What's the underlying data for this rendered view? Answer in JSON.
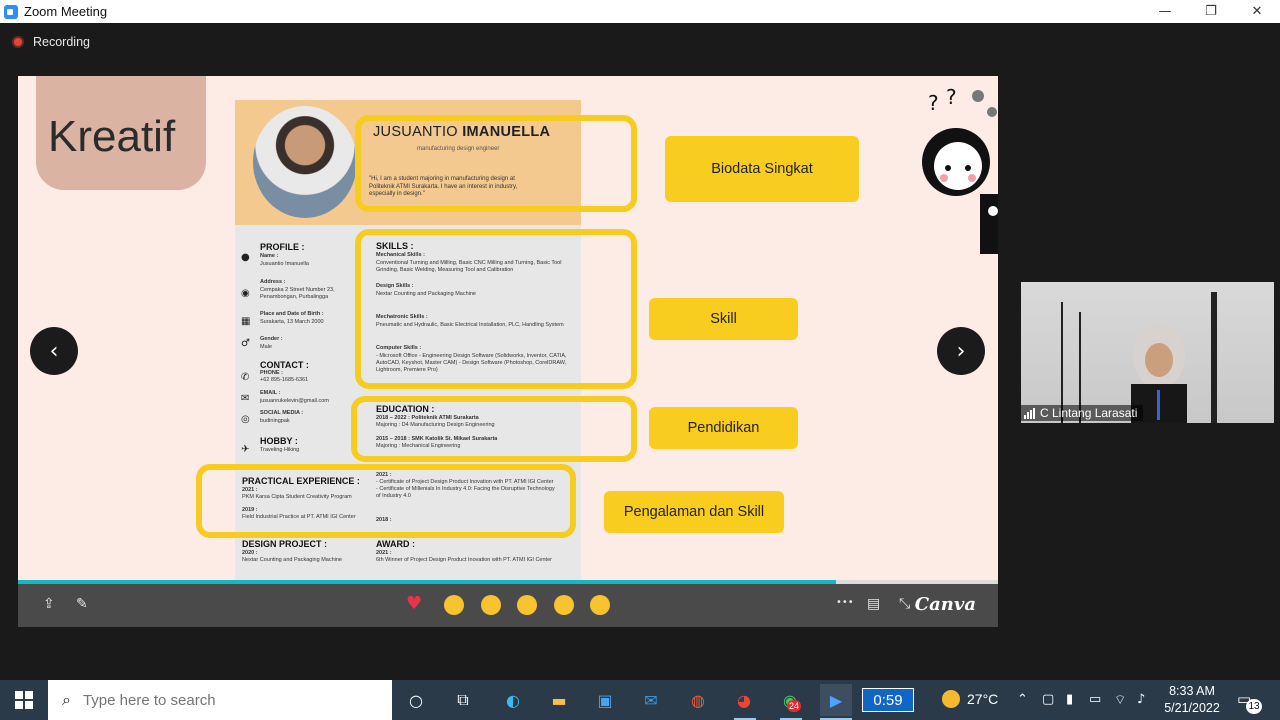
{
  "window": {
    "title": "Zoom Meeting",
    "minimize": "—",
    "restore": "❐",
    "close": "✕"
  },
  "recording": {
    "label": "Recording"
  },
  "slide": {
    "heading": "Kreatif",
    "cv": {
      "first_name": "JUSUANTIO",
      "last_name": "IMANUELLA",
      "subtitle": "manufacturing design engineer",
      "quote": "\"Hi, I am a student majoring in manufacturing design at Politeknik ATMI Surakarta. I have an interest in industry, especially in design.\"",
      "profile_heading": "PROFILE :",
      "name_label": "Name :",
      "name_value": "Jusuantio Imanuella",
      "address_label": "Address :",
      "address_value": "Cempaka 2 Street Number 23, Penambongan, Purbalingga",
      "birth_label": "Place and Date of Birth :",
      "birth_value": "Surakarta, 13 March 2000",
      "gender_label": "Gender :",
      "gender_value": "Male",
      "contact_heading": "CONTACT :",
      "phone_label": "PHONE :",
      "phone_value": "+62 895-1685-6361",
      "email_label": "EMAIL :",
      "email_value": "jusuanrukelevin@gmail.com",
      "social_label": "SOCIAL MEDIA :",
      "social_value": "budiningpak",
      "hobby_heading": "HOBBY :",
      "hobby_value": "Traveling Hiking",
      "skills_heading": "SKILLS :",
      "mech_label": "Mechanical Skills :",
      "mech_value": "Conventional Turning and Milling, Basic CNC Milling and Turning, Basic Tool Grinding, Basic Welding, Measuring Tool and Calibration",
      "design_label": "Design Skills :",
      "design_value": "Nextar Counting and Packaging Machine",
      "mecha_label": "Mechatronic Skills :",
      "mecha_value": "Pneumatic and Hydraulic, Basic Electrical Installation, PLC, Handling System",
      "computer_label": "Computer Skills :",
      "computer_value": "- Microsoft Office - Engineering Design Software (Solidworks, Inventor, CATIA, AutoCAD, Keyshot, Master CAM) - Design Software (Photoshop, CorelDRAW, Lightroom, Premiere Pro)",
      "education_heading": "EDUCATION :",
      "edu1_title": "2018 – 2022 : Politeknik ATMI Surakarta",
      "edu1_major": "Majoring : D4 Manufacturing Design Engineering",
      "edu2_title": "2015 – 2018 : SMK Katolik St. Mikael Surakarta",
      "edu2_major": "Majoring : Mechanical Engineering",
      "practical_heading": "PRACTICAL EXPERIENCE :",
      "prac1_year": "2021 :",
      "prac1_value": "PKM Karsa Cipta Student Creativity Program",
      "prac2_year": "2019 :",
      "prac2_value": "Field Industrial Practice at PT. ATMI IGI Center",
      "cert_year": "2021 :",
      "cert_value": "- Certificate of Project Design Product Inovation with PT. ATMI IGI Center - Certificate of Millenials In Industry 4.0: Facing the Disruptive Technology of Industry 4.0",
      "cert2_year": "2018 :",
      "design_heading": "DESIGN PROJECT :",
      "design_year": "2020 :",
      "award_heading": "AWARD :",
      "award_year": "2021 :",
      "award_value": "6th Winner of Project Design Product Inovation with PT. ATMI IGI Center"
    },
    "labels": {
      "biodata": "Biodata Singkat",
      "skill": "Skill",
      "pendidikan": "Pendidikan",
      "pengalaman": "Pengalaman dan Skill"
    },
    "progress": 0.835
  },
  "canva_bar": {
    "logo": "Canva",
    "more": "•••"
  },
  "participant": {
    "name": "C Lintang Larasati"
  },
  "taskbar": {
    "search_placeholder": "Type here to search",
    "timer": "0:59",
    "temperature": "27°C",
    "time": "8:33 AM",
    "date": "5/21/2022",
    "whatsapp_badge": "24",
    "notification_count": "13"
  },
  "colors": {
    "highlight": "#f7cc20",
    "zoom_blue": "#2D8CFF",
    "slide_bg": "#fdece6"
  }
}
